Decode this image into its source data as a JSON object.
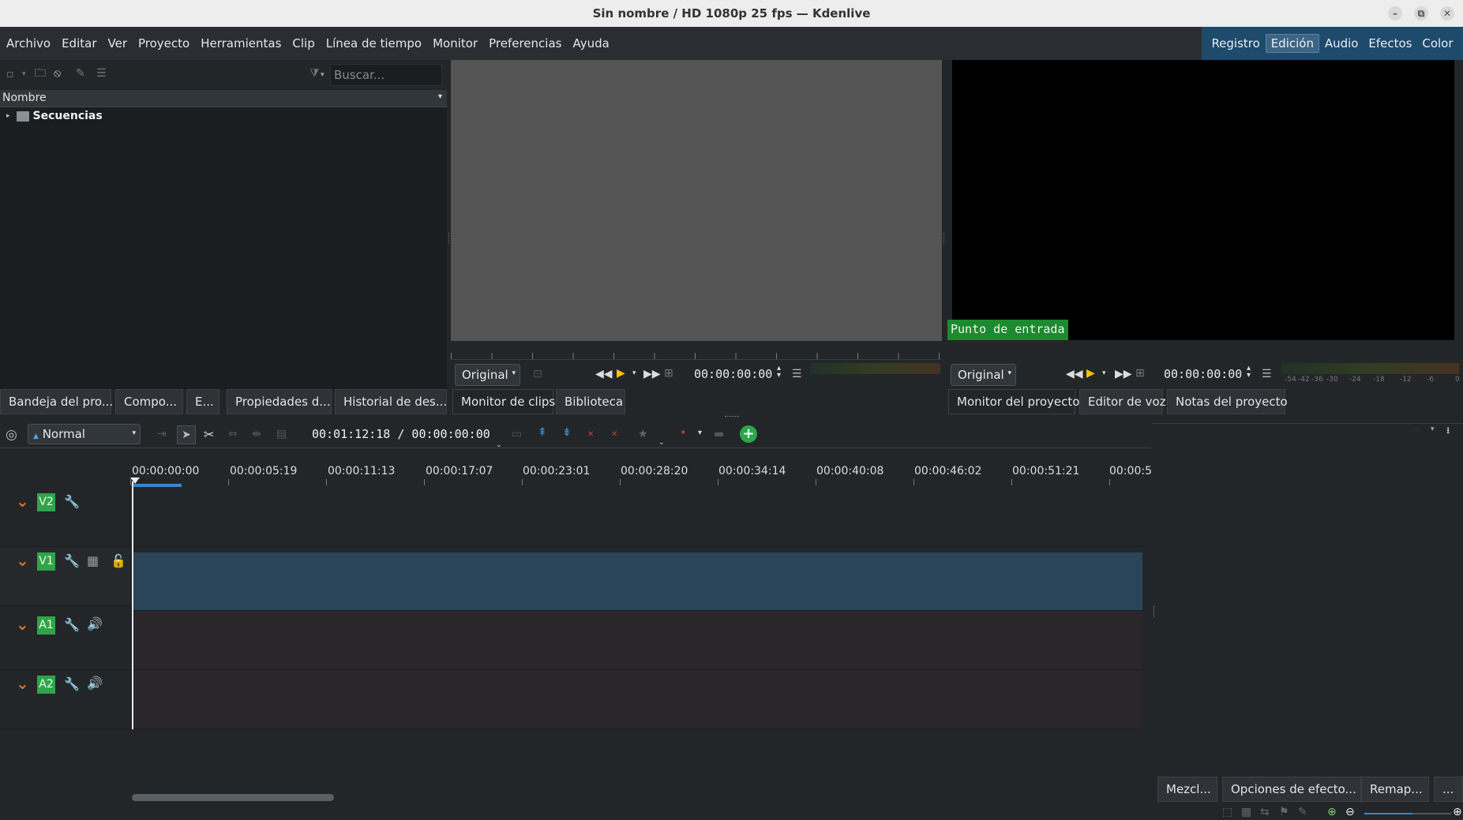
{
  "window": {
    "title": "Sin nombre / HD 1080p 25 fps — Kdenlive",
    "minimize_icon": "–",
    "maximize_icon": "⧉",
    "close_icon": "✕"
  },
  "menu": [
    "Archivo",
    "Editar",
    "Ver",
    "Proyecto",
    "Herramientas",
    "Clip",
    "Línea de tiempo",
    "Monitor",
    "Preferencias",
    "Ayuda"
  ],
  "layouts": {
    "items": [
      "Registro",
      "Edición",
      "Audio",
      "Efectos",
      "Color"
    ],
    "active": "Edición"
  },
  "bin": {
    "search_placeholder": "Buscar...",
    "column_header": "Nombre",
    "folder": "Secuencias"
  },
  "clip_monitor": {
    "zoom": "Original",
    "timecode": "00:00:00:00"
  },
  "project_monitor": {
    "overlay_label": "Punto de entrada",
    "zoom": "Original",
    "timecode": "00:00:00:00",
    "meter_labels": [
      "-54",
      "-42",
      "-36",
      "-30",
      "-24",
      "-18",
      "-12",
      "-6",
      "0"
    ]
  },
  "left_tabs": [
    "Bandeja del pro...",
    "Compo...",
    "E...",
    "Propiedades d...",
    "Historial de des..."
  ],
  "clip_tabs": [
    "Monitor de clips",
    "Biblioteca"
  ],
  "project_tabs": [
    "Monitor del proyecto",
    "Editor de voz",
    "Notas del proyecto"
  ],
  "timeline": {
    "mode": "Normal",
    "timecode": "00:01:12:18 / 00:00:00:00",
    "ruler": [
      "00:00:00:00",
      "00:00:05:19",
      "00:00:11:13",
      "00:00:17:07",
      "00:00:23:01",
      "00:00:28:20",
      "00:00:34:14",
      "00:00:40:08",
      "00:00:46:02",
      "00:00:51:21",
      "00:00:5"
    ],
    "tracks": [
      "V2",
      "V1",
      "A1",
      "A2"
    ]
  },
  "bottom_tabs": [
    "Mezcl...",
    "Opciones de efecto...",
    "Remap...",
    "..."
  ],
  "colors": {
    "track_badge": "#2fa44a",
    "inpoint": "#1c8a2e",
    "selected_track": "#2b4457",
    "layout_bar": "#1e4a6b"
  }
}
